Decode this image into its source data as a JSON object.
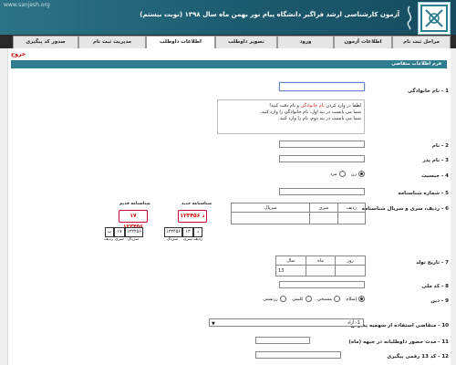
{
  "header": {
    "title": "آزمون کارشناسی ارشد فراگیر دانشگاه پیام نور بهمن ماه سال ۱۳۹۸ (نوبت بیستم)",
    "site_link": "www.sanjesh.org",
    "logo_text": "سازمان سنجش"
  },
  "exit_label": "خروج",
  "menu": {
    "tabs": [
      {
        "label": "مراحل ثبت نام",
        "active": false
      },
      {
        "label": "اطلاعات آزمون",
        "active": false
      },
      {
        "label": "ورود",
        "active": false
      },
      {
        "label": "تصویر داوطلب",
        "active": false
      },
      {
        "label": "اطلاعات داوطلب",
        "active": true
      },
      {
        "label": "مدیریت ثبت نام",
        "active": false
      },
      {
        "label": "صدور کد پیگیری",
        "active": false
      }
    ]
  },
  "form": {
    "header": "فرم اطلاعات متقاضی",
    "fields": {
      "last_name": {
        "label": "1 - نام خانوادگی",
        "value": ""
      },
      "first_name": {
        "label": "2 - نام",
        "value": ""
      },
      "father_name": {
        "label": "3 - نام پدر",
        "value": ""
      },
      "gender": {
        "label": "4 - جنسیت",
        "options": [
          "زن",
          "مرد"
        ],
        "selected": "زن"
      },
      "id_number": {
        "label": "5 - شماره شناسنامه",
        "value": ""
      },
      "serial": {
        "label": "6 - ردیف، سری و سریال شناسنامه",
        "headers": [
          "سریال",
          "سری",
          "ردیف"
        ]
      },
      "birth_date": {
        "label": "7 - تاریخ تولد",
        "headers": [
          "روز",
          "ماه",
          "سال"
        ],
        "year_prefix": "13"
      },
      "national_code": {
        "label": "8 - کد ملی",
        "value": ""
      },
      "religion": {
        "label": "9 - دین",
        "options": [
          "اسلام",
          "مسیحی",
          "کلیمی",
          "زرتشتی"
        ],
        "selected": "اسلام"
      },
      "quota": {
        "label": "10 - متقاضی استفاده از سهمیه پذیرش:",
        "selected": "1- آزاد",
        "arrow": "▼"
      },
      "service_duration": {
        "label": "11 - مدت حضور داوطلبانه در جبهه (ماه)",
        "value": ""
      },
      "tracking_code": {
        "label": "12 - کد 13 رقمی پیگیری",
        "value": ""
      }
    },
    "hint": {
      "line1_prefix": "لطفا در وارد کردن",
      "line1_highlight": "نام خانوادگی",
      "line1_suffix": "و نام دقت کنید!",
      "line2": "شما می بایست در بند اول، نام خانوادگی را وارد کنید.",
      "line3": "شما می بایست در بند دوم، نام را وارد کنید."
    },
    "samples": {
      "old": {
        "title": "شناسنامه قدیم",
        "stamp_prefix": "۱۷",
        "stamp_number": "۱۲۳۴۵۶",
        "boxes": [
          "۱۲۳۴۵۶",
          "۱۷",
          "ب"
        ],
        "captions": [
          "سریال",
          "سری",
          "ردیف"
        ]
      },
      "new": {
        "title": "شناسنامه جدید",
        "stamp_prefix": "د",
        "stamp_number": "۱۲۳۴۵۶",
        "boxes": [
          "۱۲۳۴۵۶",
          "۱۳",
          "د"
        ],
        "captions": [
          "سریال",
          "سری",
          "ردیف"
        ]
      }
    }
  },
  "colors": {
    "header_bg": "#1e5f74",
    "menu_bg": "#2a2a2a",
    "form_header_bg": "#2f7e90",
    "highlight": "#e02020"
  }
}
